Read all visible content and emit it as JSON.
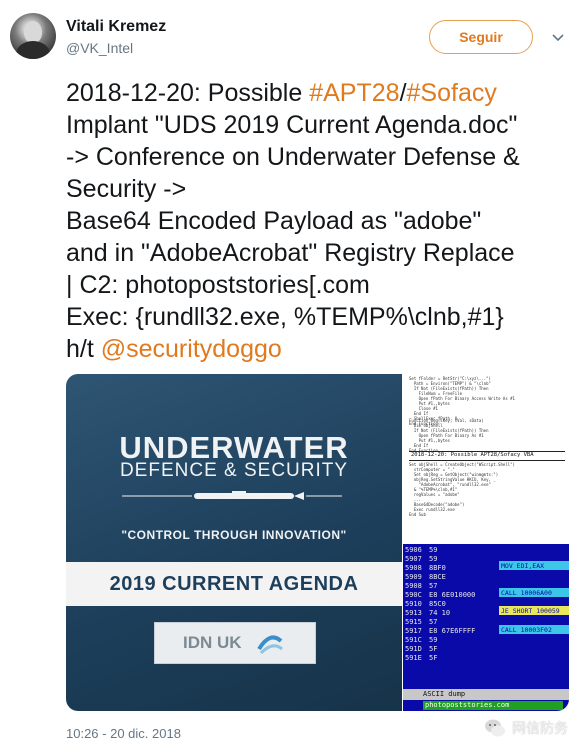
{
  "author": {
    "name": "Vitali Kremez",
    "handle": "@VK_Intel"
  },
  "follow_label": "Seguir",
  "tweet": {
    "line1_prefix": "2018-12-20: Possible ",
    "tag1": "#APT28",
    "slash": "/",
    "tag2": "#Sofacy",
    "line2": "Implant \"UDS 2019 Current Agenda.doc\"",
    "line3": "-> Conference on Underwater Defense &",
    "line4": "Security ->",
    "line5": "Base64 Encoded Payload as \"adobe\"",
    "line6": "and in \"AdobeAcrobat\" Registry Replace",
    "line7": "| C2: photopoststories[.com",
    "line8": "Exec: {rundll32.exe, %TEMP%\\clnb,#1}",
    "line9_prefix": "h/t ",
    "mention": "@securitydoggo"
  },
  "media": {
    "poster": {
      "title1": "UNDERWATER",
      "title2": "DEFENCE & SECURITY",
      "tagline": "\"CONTROL THROUGH INNOVATION\"",
      "agenda": "2019 CURRENT AGENDA",
      "logo": "IDN UK"
    },
    "vba_title": "2018-12-20: Possible APT28/Sofacy VBA",
    "hex_rows": [
      {
        "addr": "5906",
        "bytes": "59"
      },
      {
        "addr": "5907",
        "bytes": "59"
      },
      {
        "addr": "5908",
        "bytes": "8BF0"
      },
      {
        "addr": "5909",
        "bytes": "8BCE"
      },
      {
        "addr": "5908",
        "bytes": "57"
      },
      {
        "addr": "590C",
        "bytes": "E8 6E010000"
      },
      {
        "addr": "5910",
        "bytes": "85C0"
      },
      {
        "addr": "5913",
        "bytes": "74 10"
      },
      {
        "addr": "5915",
        "bytes": "57"
      },
      {
        "addr": "5917",
        "bytes": "E8 67E6FFFF"
      },
      {
        "addr": "591C",
        "bytes": "59"
      },
      {
        "addr": "591D",
        "bytes": "5F"
      },
      {
        "addr": "591E",
        "bytes": "5F"
      }
    ],
    "asm": {
      "mov": "MOV EDI,EAX",
      "call1": "CALL 10006A00",
      "je": "JE SHORT 100059",
      "call2": "CALL 10003F02"
    },
    "ascii_label": "ASCII dump",
    "c2_text": "photopoststories.com"
  },
  "timestamp": "10:26 - 20 dic. 2018",
  "watermark": "网信防务",
  "colors": {
    "accent": "#e07a1f",
    "name": "#14171a",
    "meta": "#657786"
  }
}
